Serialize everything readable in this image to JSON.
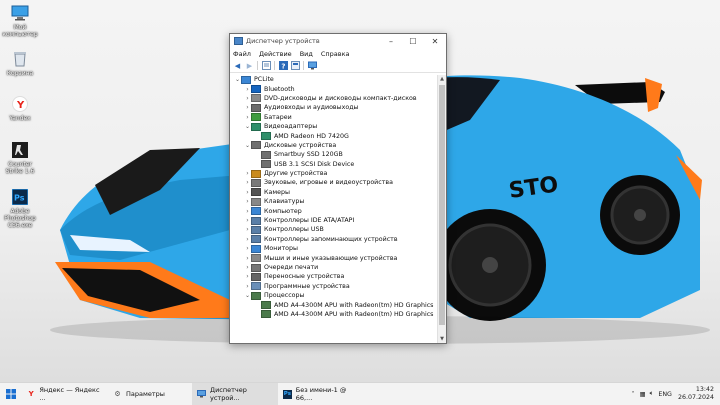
{
  "desktop": {
    "icons": [
      {
        "label": "Мой компьютер",
        "icon": "computer-icon"
      },
      {
        "label": "Корзина",
        "icon": "recycle-bin-icon"
      },
      {
        "label": "Yandex",
        "icon": "yandex-browser-icon"
      },
      {
        "label": "Counter Strike 1.6",
        "icon": "counter-strike-icon"
      },
      {
        "label": "Adobe Photoshop CS6.exe",
        "icon": "photoshop-icon"
      }
    ],
    "wallpaper_car_text": "STO"
  },
  "window": {
    "title": "Диспетчер устройств",
    "menu": [
      "Файл",
      "Действие",
      "Вид",
      "Справка"
    ],
    "tree": [
      {
        "label": "PCLite",
        "level": 0,
        "expander": "v",
        "icon": "computer-icon"
      },
      {
        "label": "Bluetooth",
        "level": 1,
        "expander": ">",
        "icon": "bluetooth-icon"
      },
      {
        "label": "DVD-дисководы и дисководы компакт-дисков",
        "level": 1,
        "expander": ">",
        "icon": "dvd-drive-icon"
      },
      {
        "label": "Аудиовходы и аудиовыходы",
        "level": 1,
        "expander": ">",
        "icon": "audio-io-icon"
      },
      {
        "label": "Батареи",
        "level": 1,
        "expander": ">",
        "icon": "battery-icon"
      },
      {
        "label": "Видеоадаптеры",
        "level": 1,
        "expander": "v",
        "icon": "display-adapter-icon"
      },
      {
        "label": "AMD Radeon HD 7420G",
        "level": 2,
        "expander": "",
        "icon": "display-adapter-icon"
      },
      {
        "label": "Дисковые устройства",
        "level": 1,
        "expander": "v",
        "icon": "disk-drive-icon"
      },
      {
        "label": "Smartbuy SSD 120GB",
        "level": 2,
        "expander": "",
        "icon": "disk-drive-icon"
      },
      {
        "label": "USB 3.1 SCSI Disk Device",
        "level": 2,
        "expander": "",
        "icon": "disk-drive-icon"
      },
      {
        "label": "Другие устройства",
        "level": 1,
        "expander": ">",
        "icon": "other-devices-icon"
      },
      {
        "label": "Звуковые, игровые и видеоустройства",
        "level": 1,
        "expander": ">",
        "icon": "sound-icon"
      },
      {
        "label": "Камеры",
        "level": 1,
        "expander": ">",
        "icon": "camera-icon"
      },
      {
        "label": "Клавиатуры",
        "level": 1,
        "expander": ">",
        "icon": "keyboard-icon"
      },
      {
        "label": "Компьютер",
        "level": 1,
        "expander": ">",
        "icon": "computer-icon"
      },
      {
        "label": "Контроллеры IDE ATA/ATAPI",
        "level": 1,
        "expander": ">",
        "icon": "ide-controller-icon"
      },
      {
        "label": "Контроллеры USB",
        "level": 1,
        "expander": ">",
        "icon": "usb-icon"
      },
      {
        "label": "Контроллеры запоминающих устройств",
        "level": 1,
        "expander": ">",
        "icon": "storage-controller-icon"
      },
      {
        "label": "Мониторы",
        "level": 1,
        "expander": ">",
        "icon": "monitor-icon"
      },
      {
        "label": "Мыши и иные указывающие устройства",
        "level": 1,
        "expander": ">",
        "icon": "mouse-icon"
      },
      {
        "label": "Очереди печати",
        "level": 1,
        "expander": ">",
        "icon": "printer-icon"
      },
      {
        "label": "Переносные устройства",
        "level": 1,
        "expander": ">",
        "icon": "portable-device-icon"
      },
      {
        "label": "Программные устройства",
        "level": 1,
        "expander": ">",
        "icon": "software-device-icon"
      },
      {
        "label": "Процессоры",
        "level": 1,
        "expander": "v",
        "icon": "processor-icon"
      },
      {
        "label": "AMD A4-4300M APU with Radeon(tm) HD Graphics",
        "level": 2,
        "expander": "",
        "icon": "processor-icon"
      },
      {
        "label": "AMD A4-4300M APU with Radeon(tm) HD Graphics",
        "level": 2,
        "expander": "",
        "icon": "processor-icon"
      }
    ]
  },
  "taskbar": {
    "items": [
      {
        "label": "Яндекс — Яндекс ...",
        "icon": "yandex-browser-icon"
      },
      {
        "label": "Параметры",
        "icon": "settings-gear-icon"
      },
      {
        "label": "Диспетчер устрой...",
        "icon": "device-manager-icon"
      },
      {
        "label": "Без имени-1 @ 66,...",
        "icon": "photoshop-icon"
      }
    ],
    "lang": "ENG",
    "time": "13:42",
    "date": "26.07.2024"
  },
  "colors": {
    "car_blue": "#2ea7e8",
    "car_orange": "#ff7a1a",
    "selection": "#cce4f7"
  }
}
